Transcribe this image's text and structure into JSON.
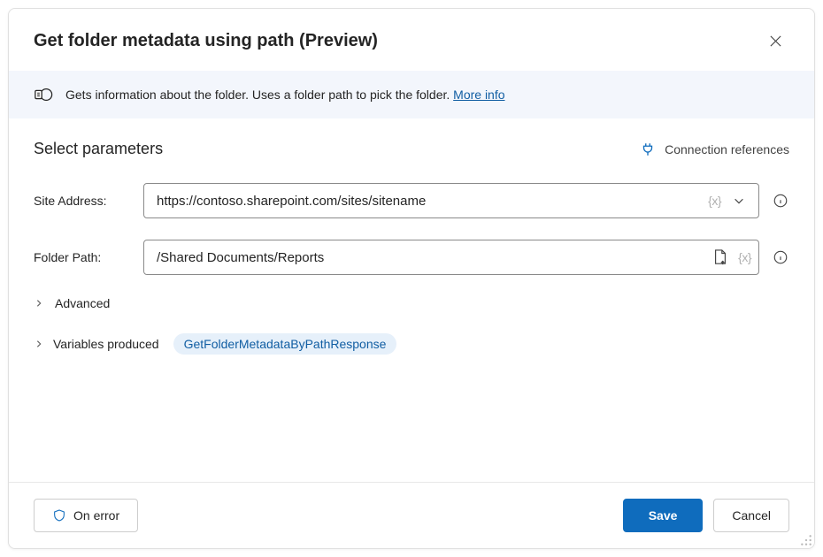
{
  "header": {
    "title": "Get folder metadata using path (Preview)"
  },
  "banner": {
    "text": "Gets information about the folder. Uses a folder path to pick the folder. ",
    "link_label": "More info"
  },
  "section": {
    "title": "Select parameters",
    "connection_label": "Connection references"
  },
  "params": {
    "site": {
      "label": "Site Address:",
      "value": "https://contoso.sharepoint.com/sites/sitename",
      "var_hint": "{x}"
    },
    "folder": {
      "label": "Folder Path:",
      "value": "/Shared Documents/Reports",
      "var_hint": "{x}"
    }
  },
  "advanced_label": "Advanced",
  "variables_label": "Variables produced",
  "variable_chip": "GetFolderMetadataByPathResponse",
  "footer": {
    "on_error": "On error",
    "save": "Save",
    "cancel": "Cancel"
  }
}
